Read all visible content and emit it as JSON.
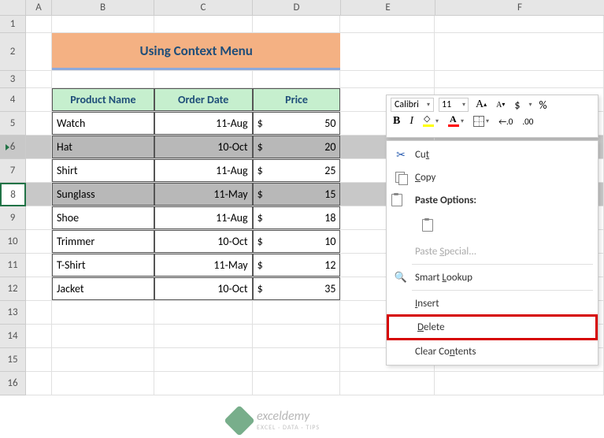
{
  "columns": [
    "A",
    "B",
    "C",
    "D",
    "E",
    "F"
  ],
  "rows": [
    "1",
    "2",
    "3",
    "4",
    "5",
    "6",
    "7",
    "8",
    "9",
    "10",
    "11",
    "12",
    "13",
    "14",
    "15",
    "16"
  ],
  "title": "Using Context Menu",
  "headers": {
    "product": "Product Name",
    "order_date": "Order Date",
    "price": "Price"
  },
  "data": [
    {
      "name": "Watch",
      "date": "11-Aug",
      "cur": "$",
      "price": "50"
    },
    {
      "name": "Hat",
      "date": "10-Oct",
      "cur": "$",
      "price": "20"
    },
    {
      "name": "Shirt",
      "date": "11-Aug",
      "cur": "$",
      "price": "25"
    },
    {
      "name": "Sunglass",
      "date": "11-May",
      "cur": "$",
      "price": "15"
    },
    {
      "name": "Shoe",
      "date": "11-Aug",
      "cur": "$",
      "price": "18"
    },
    {
      "name": "Trimmer",
      "date": "10-Oct",
      "cur": "$",
      "price": "10"
    },
    {
      "name": "T-Shirt",
      "date": "11-May",
      "cur": "$",
      "price": "12"
    },
    {
      "name": "Jacket",
      "date": "10-Oct",
      "cur": "$",
      "price": "35"
    }
  ],
  "mini_toolbar": {
    "font": "Calibri",
    "size": "11",
    "inc_a": "A",
    "dec_a": "A",
    "currency": "$",
    "percent": "%",
    "bold": "B",
    "italic": "I",
    "decimal_inc": "←.0",
    "decimal_dec": ".00"
  },
  "context_menu": {
    "cut": "Cut",
    "copy": "Copy",
    "paste_options": "Paste Options:",
    "paste_special": "Paste Special...",
    "smart_lookup": "Smart Lookup",
    "insert": "Insert",
    "delete": "Delete",
    "clear_contents": "Clear Contents"
  },
  "watermark": {
    "brand": "exceldemy",
    "tag": "EXCEL · DATA · TIPS"
  },
  "chart_data": {
    "type": "table",
    "title": "Using Context Menu",
    "columns": [
      "Product Name",
      "Order Date",
      "Price"
    ],
    "rows": [
      [
        "Watch",
        "11-Aug",
        50
      ],
      [
        "Hat",
        "10-Oct",
        20
      ],
      [
        "Shirt",
        "11-Aug",
        25
      ],
      [
        "Sunglass",
        "11-May",
        15
      ],
      [
        "Shoe",
        "11-Aug",
        18
      ],
      [
        "Trimmer",
        "10-Oct",
        10
      ],
      [
        "T-Shirt",
        "11-May",
        12
      ],
      [
        "Jacket",
        "10-Oct",
        35
      ]
    ]
  }
}
